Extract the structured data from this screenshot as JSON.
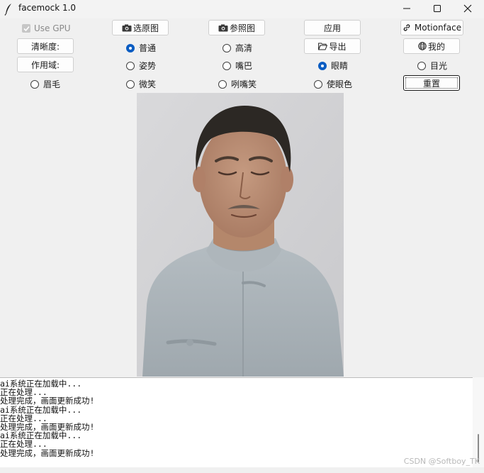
{
  "window": {
    "title": "facemock 1.0",
    "controls": {
      "minimize": "minimize",
      "maximize": "maximize",
      "close": "close"
    }
  },
  "toolbar": {
    "use_gpu": {
      "label": "Use GPU",
      "checked": true,
      "disabled": true
    },
    "select_original_label": "选原图",
    "reference_label": "参照图",
    "apply_label": "应用",
    "motionface_label": "Motionface",
    "clarity_label": "清晰度:",
    "export_label": "导出",
    "mine_label": "我的",
    "scope_label": "作用域:",
    "reset_label": "重置"
  },
  "clarity_options": [
    {
      "label": "普通",
      "selected": true
    },
    {
      "label": "高清",
      "selected": false
    }
  ],
  "scope_options": [
    {
      "label": "姿势",
      "selected": false
    },
    {
      "label": "嘴巴",
      "selected": false
    },
    {
      "label": "眼睛",
      "selected": true
    },
    {
      "label": "目光",
      "selected": false
    },
    {
      "label": "眉毛",
      "selected": false
    },
    {
      "label": "微笑",
      "selected": false
    },
    {
      "label": "咧嘴笑",
      "selected": false
    },
    {
      "label": "使眼色",
      "selected": false
    }
  ],
  "log": {
    "lines": [
      "ai系统正在加载中...",
      "正在处理...",
      "处理完成，画面更新成功!",
      "ai系统正在加载中...",
      "正在处理...",
      "处理完成，画面更新成功!",
      "ai系统正在加载中...",
      "正在处理...",
      "处理完成，画面更新成功!"
    ]
  },
  "watermark": "CSDN @Softboy_TK",
  "colors": {
    "accent": "#0a5cc2",
    "window_bg": "#f0f0f0",
    "button_bg": "#fdfdfd"
  }
}
